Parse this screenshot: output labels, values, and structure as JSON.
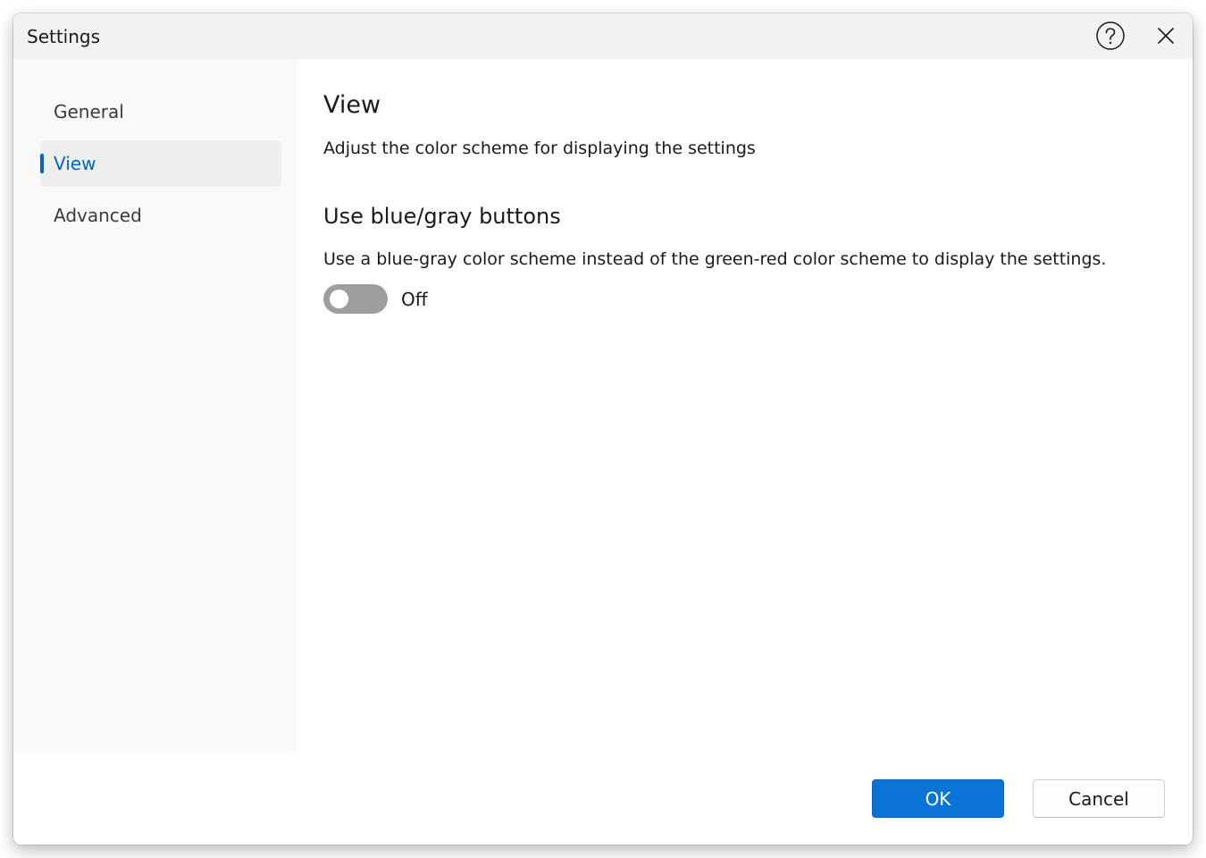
{
  "window": {
    "title": "Settings"
  },
  "sidebar": {
    "items": [
      {
        "label": "General",
        "selected": false
      },
      {
        "label": "View",
        "selected": true
      },
      {
        "label": "Advanced",
        "selected": false
      }
    ]
  },
  "content": {
    "title": "View",
    "description": "Adjust the color scheme for displaying the settings",
    "section": {
      "title": "Use blue/gray buttons",
      "description": "Use a blue-gray color scheme instead of the green-red color scheme to display the settings.",
      "toggle_state": "Off"
    }
  },
  "footer": {
    "ok_label": "OK",
    "cancel_label": "Cancel"
  },
  "colors": {
    "accent": "#0067c0",
    "ok_button": "#0a74d6",
    "toggle_off": "#9e9e9e"
  },
  "icons": {
    "help": "help-circle-icon",
    "close": "close-icon"
  }
}
